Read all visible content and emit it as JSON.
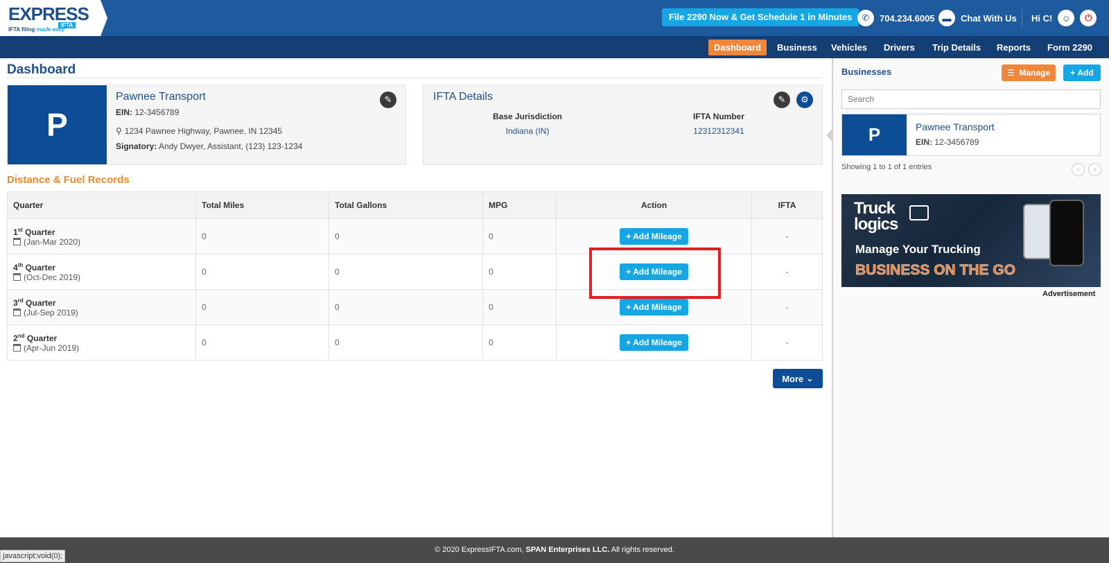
{
  "brand": {
    "logo_main": "EXPRESS",
    "logo_product": "IFTA",
    "tagline_plain": "IFTA filing",
    "tagline_script": "made easy"
  },
  "header": {
    "promo": "File 2290 Now & Get Schedule 1 in Minutes",
    "phone": "704.234.6005",
    "chat": "Chat With Us",
    "greeting": "Hi C!"
  },
  "nav": [
    "Dashboard",
    "Business",
    "Vehicles",
    "Drivers",
    "Trip Details",
    "Reports",
    "Form 2290"
  ],
  "page": {
    "title": "Dashboard"
  },
  "business": {
    "initial": "P",
    "name": "Pawnee Transport",
    "ein_label": "EIN:",
    "ein": "12-3456789",
    "address": "1234 Pawnee Highway, Pawnee, IN 12345",
    "signatory_label": "Signatory:",
    "signatory": "Andy Dwyer, Assistant, (123) 123-1234"
  },
  "ifta": {
    "title": "IFTA Details",
    "base_label": "Base Jurisdiction",
    "base_value": "Indiana (IN)",
    "number_label": "IFTA Number",
    "number_value": "12312312341"
  },
  "records": {
    "title": "Distance & Fuel Records",
    "columns": [
      "Quarter",
      "Total Miles",
      "Total Gallons",
      "MPG",
      "Action",
      "IFTA"
    ],
    "rows": [
      {
        "num": "1",
        "suffix": "st",
        "label": "Quarter",
        "range": "(Jan-Mar 2020)",
        "miles": "0",
        "gallons": "0",
        "mpg": "0",
        "action": "Add Mileage",
        "ifta": "-"
      },
      {
        "num": "4",
        "suffix": "th",
        "label": "Quarter",
        "range": "(Oct-Dec 2019)",
        "miles": "0",
        "gallons": "0",
        "mpg": "0",
        "action": "Add Mileage",
        "ifta": "-"
      },
      {
        "num": "3",
        "suffix": "rd",
        "label": "Quarter",
        "range": "(Jul-Sep 2019)",
        "miles": "0",
        "gallons": "0",
        "mpg": "0",
        "action": "Add Mileage",
        "ifta": "-"
      },
      {
        "num": "2",
        "suffix": "nd",
        "label": "Quarter",
        "range": "(Apr-Jun 2019)",
        "miles": "0",
        "gallons": "0",
        "mpg": "0",
        "action": "Add Mileage",
        "ifta": "-"
      }
    ],
    "more": "More"
  },
  "sidebar": {
    "title": "Businesses",
    "manage": "Manage",
    "add": "Add",
    "search_placeholder": "Search",
    "biz_initial": "P",
    "biz_name": "Pawnee Transport",
    "biz_ein_label": "EIN:",
    "biz_ein": "12-3456789",
    "entries": "Showing 1 to 1 of 1 entries",
    "ad_brand_1": "Truck",
    "ad_brand_2": "logics",
    "ad_line1": "Manage Your Trucking",
    "ad_line2": "BUSINESS ON THE GO",
    "ad_label": "Advertisement"
  },
  "footer": {
    "prefix": "© 2020 ExpressIFTA.com, ",
    "company": "SPAN Enterprises LLC.",
    "suffix": " All rights reserved."
  },
  "status_url": "javascript:void(0);",
  "colors": {
    "primary": "#1e5a9e",
    "nav": "#143f74",
    "accent_orange": "#f0863a",
    "accent_blue": "#15a7e4",
    "highlight_red": "#e41d24"
  }
}
